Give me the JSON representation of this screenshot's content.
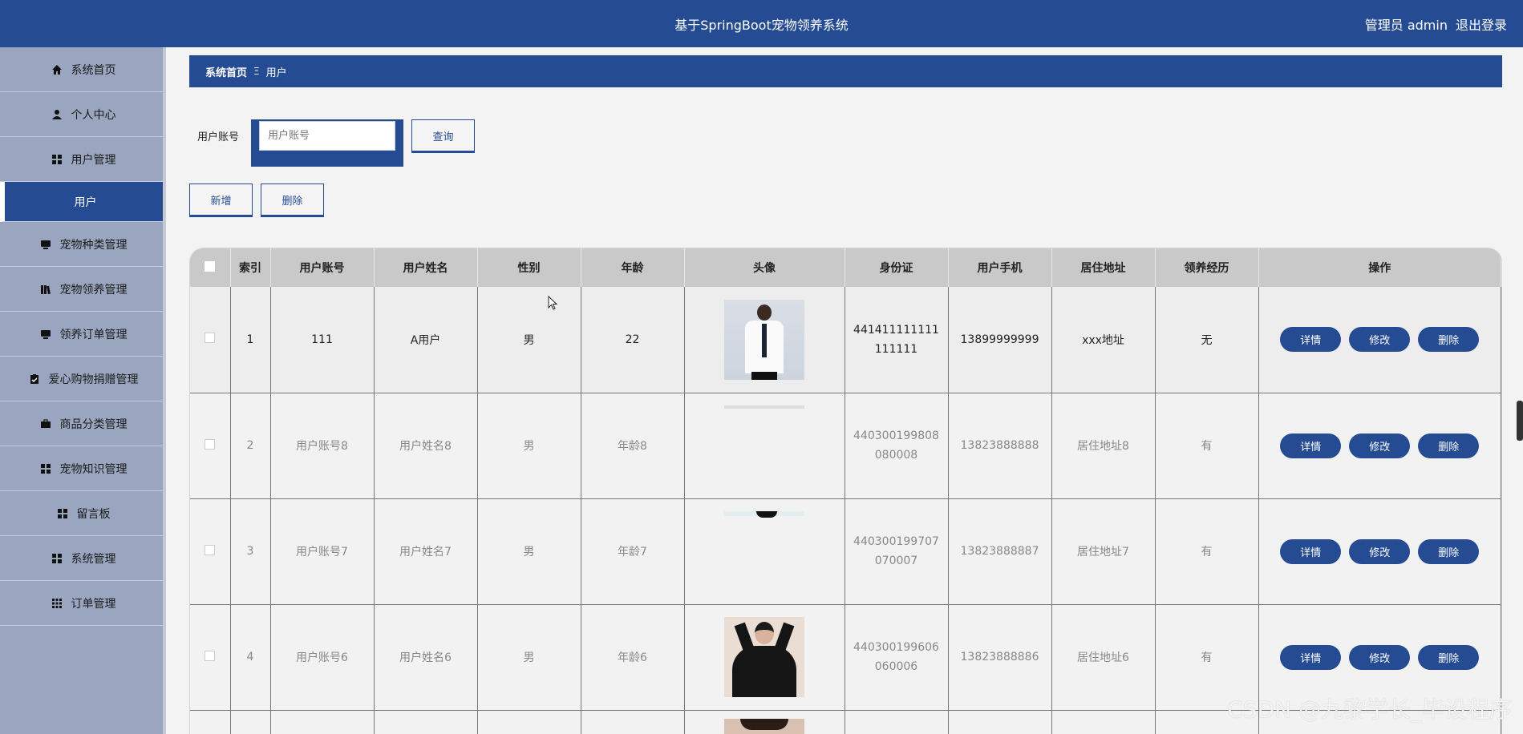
{
  "header": {
    "title": "基于SpringBoot宠物领养系统",
    "user_label": "管理员 admin",
    "logout": "退出登录"
  },
  "sidebar": {
    "items": [
      {
        "label": "系统首页",
        "icon": "home-icon"
      },
      {
        "label": "个人中心",
        "icon": "user-icon"
      },
      {
        "label": "用户管理",
        "icon": "grid-icon"
      },
      {
        "label": "用户",
        "icon": "",
        "active": true
      },
      {
        "label": "宠物种类管理",
        "icon": "monitor-icon"
      },
      {
        "label": "宠物领养管理",
        "icon": "library-icon"
      },
      {
        "label": "领养订单管理",
        "icon": "monitor-icon"
      },
      {
        "label": "爱心购物捐赠管理",
        "icon": "clipboard-icon"
      },
      {
        "label": "商品分类管理",
        "icon": "briefcase-icon"
      },
      {
        "label": "宠物知识管理",
        "icon": "grid-icon"
      },
      {
        "label": "留言板",
        "icon": "grid-icon"
      },
      {
        "label": "系统管理",
        "icon": "grid-icon"
      },
      {
        "label": "订单管理",
        "icon": "apps-icon"
      }
    ]
  },
  "breadcrumb": {
    "home": "系统首页",
    "separator": "Ξ",
    "current": "用户"
  },
  "search": {
    "label": "用户账号",
    "placeholder": "用户账号",
    "button": "查询"
  },
  "actions": {
    "add": "新增",
    "delete": "删除"
  },
  "table": {
    "columns": [
      "索引",
      "用户账号",
      "用户姓名",
      "性别",
      "年龄",
      "头像",
      "身份证",
      "用户手机",
      "居住地址",
      "领养经历",
      "操作"
    ],
    "op_labels": {
      "detail": "详情",
      "edit": "修改",
      "delete": "删除"
    },
    "rows": [
      {
        "index": "1",
        "account": "111",
        "name": "A用户",
        "gender": "男",
        "age": "22",
        "id_card": "441411111111111111",
        "phone": "13899999999",
        "address": "xxx地址",
        "experience": "无"
      },
      {
        "index": "2",
        "account": "用户账号8",
        "name": "用户姓名8",
        "gender": "男",
        "age": "年龄8",
        "id_card": "440300199808080008",
        "phone": "13823888888",
        "address": "居住地址8",
        "experience": "有"
      },
      {
        "index": "3",
        "account": "用户账号7",
        "name": "用户姓名7",
        "gender": "男",
        "age": "年龄7",
        "id_card": "440300199707070007",
        "phone": "13823888887",
        "address": "居住地址7",
        "experience": "有"
      },
      {
        "index": "4",
        "account": "用户账号6",
        "name": "用户姓名6",
        "gender": "男",
        "age": "年龄6",
        "id_card": "440300199606060006",
        "phone": "13823888886",
        "address": "居住地址6",
        "experience": "有"
      }
    ]
  },
  "watermark": "CSDN @九黎学长_毕设程序",
  "colors": {
    "primary": "#254b92",
    "sidebar": "#9aa6bf",
    "background": "#f3f3f3"
  }
}
